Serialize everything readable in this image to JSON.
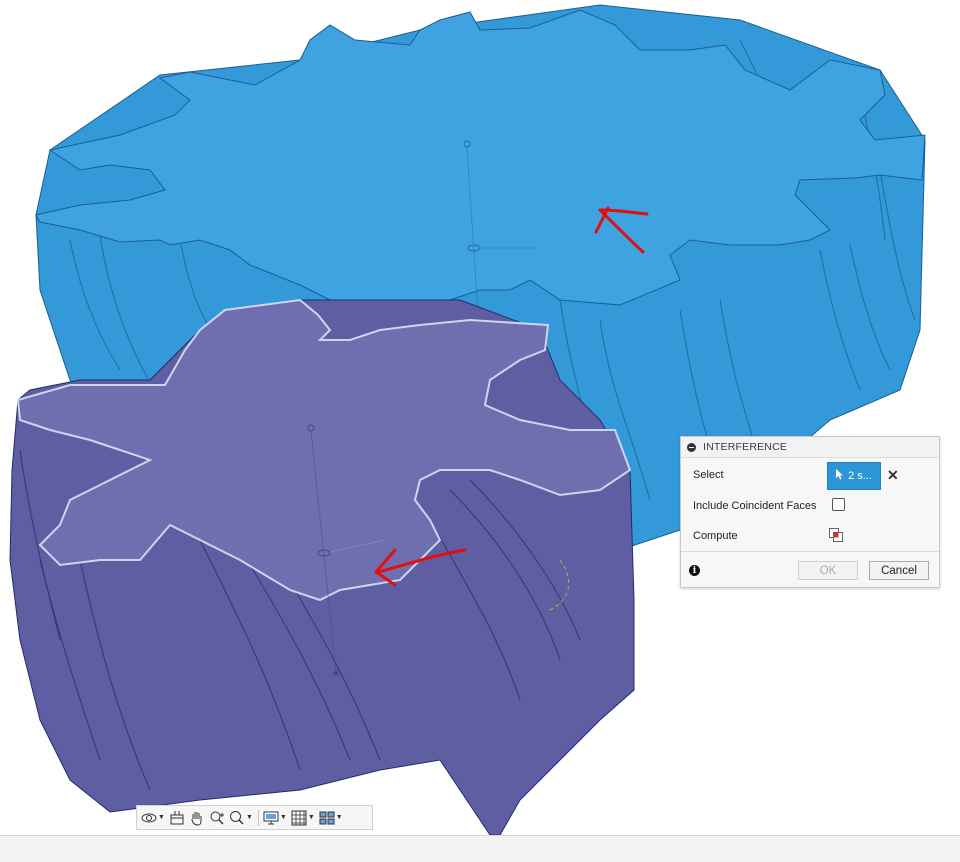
{
  "dialog": {
    "title": "INTERFERENCE",
    "select_label": "Select",
    "select_value": "2 s...",
    "include_label": "Include Coincident Faces",
    "include_checked": false,
    "compute_label": "Compute",
    "ok_label": "OK",
    "cancel_label": "Cancel"
  },
  "navbar": {
    "tools": [
      "orbit-icon",
      "look-at-icon",
      "pan-icon",
      "zoom-icon",
      "fit-icon",
      "display-settings-icon",
      "grid-icon",
      "viewports-icon"
    ]
  },
  "colors": {
    "gear_large": "#3ea0de",
    "gear_small": "#6c6aa8",
    "annotation": "#e01010",
    "select_button": "#2b95d8"
  }
}
